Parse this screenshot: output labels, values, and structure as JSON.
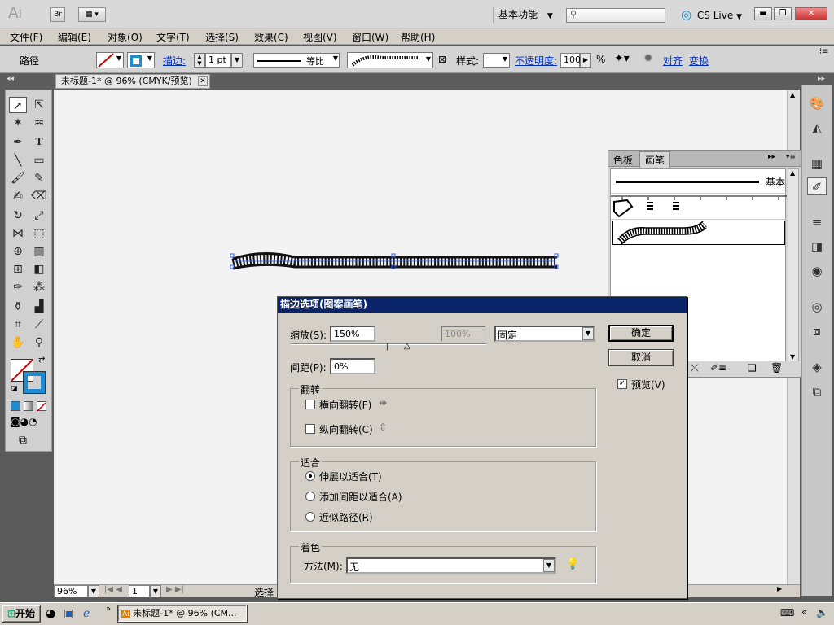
{
  "appbar": {
    "app_logo": "Ai",
    "bridge_label": "Br",
    "workspace": "基本功能",
    "search_placeholder": "",
    "cslive": "CS Live"
  },
  "menubar": {
    "items": [
      "文件(F)",
      "编辑(E)",
      "对象(O)",
      "文字(T)",
      "选择(S)",
      "效果(C)",
      "视图(V)",
      "窗口(W)",
      "帮助(H)"
    ]
  },
  "control": {
    "object_type": "路径",
    "stroke_label": "描边:",
    "stroke_weight": "1 pt",
    "stroke_profile": "等比",
    "style_label": "样式:",
    "opacity_label": "不透明度:",
    "opacity_value": "100",
    "opacity_unit": "%",
    "align_label": "对齐",
    "transform_label": "变换"
  },
  "document": {
    "tab_title": "未标题-1* @ 96% (CMYK/预览)"
  },
  "status": {
    "zoom": "96%",
    "page": "1",
    "status_text": "选择"
  },
  "brush_panel": {
    "tabs": [
      "色板",
      "画笔"
    ],
    "basic_label": "基本"
  },
  "dialog": {
    "title": "描边选项(图案画笔)",
    "scale_label": "缩放(S):",
    "scale_value": "150%",
    "scale_max_value": "100%",
    "scale_mode": "固定",
    "spacing_label": "间距(P):",
    "spacing_value": "0%",
    "flip_group": "翻转",
    "flip_h": "横向翻转(F)",
    "flip_v": "纵向翻转(C)",
    "fit_group": "适合",
    "fit_options": [
      "伸展以适合(T)",
      "添加间距以适合(A)",
      "近似路径(R)"
    ],
    "color_group": "着色",
    "method_label": "方法(M):",
    "method_value": "无",
    "ok_button": "确定",
    "cancel_button": "取消",
    "preview_label": "预览(V)",
    "preview_checked": true
  },
  "taskbar": {
    "start": "开始",
    "task_title": "未标题-1* @ 96% (CM..."
  },
  "colors": {
    "title_bar": "#0a246a",
    "accent_blue": "#1e8cd0",
    "stroke_red": "#c00000"
  }
}
